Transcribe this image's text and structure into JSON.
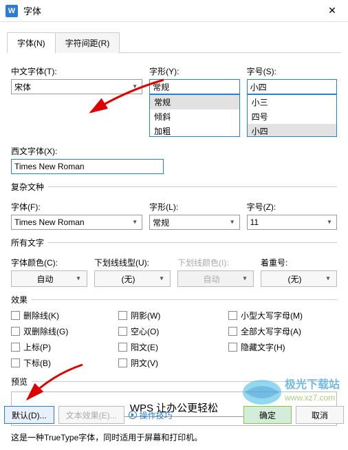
{
  "title": "字体",
  "app_icon": "W",
  "tabs": {
    "font": "字体(N)",
    "spacing": "字符间距(R)"
  },
  "main": {
    "chinese_font_label": "中文字体(T):",
    "chinese_font_value": "宋体",
    "style_label": "字形(Y):",
    "style_value": "常规",
    "style_options": [
      "常规",
      "倾斜",
      "加粗"
    ],
    "size_label": "字号(S):",
    "size_value": "小四",
    "size_options": [
      "小三",
      "四号",
      "小四"
    ],
    "western_font_label": "西文字体(X):",
    "western_font_value": "Times New Roman"
  },
  "complex": {
    "header": "复杂文种",
    "font_label": "字体(F):",
    "font_value": "Times New Roman",
    "style_label": "字形(L):",
    "style_value": "常规",
    "size_label": "字号(Z):",
    "size_value": "11"
  },
  "alltext": {
    "header": "所有文字",
    "color_label": "字体颜色(C):",
    "color_value": "自动",
    "underline_label": "下划线线型(U):",
    "underline_value": "(无)",
    "ul_color_label": "下划线颜色(I):",
    "ul_color_value": "自动",
    "emphasis_label": "着重号:",
    "emphasis_value": "(无)"
  },
  "effects": {
    "header": "效果",
    "strike": "删除线(K)",
    "dstrike": "双删除线(G)",
    "super": "上标(P)",
    "sub": "下标(B)",
    "shadow": "阴影(W)",
    "hollow": "空心(O)",
    "emboss": "阳文(E)",
    "engrave": "阴文(V)",
    "smallcaps": "小型大写字母(M)",
    "allcaps": "全部大写字母(A)",
    "hidden": "隐藏文字(H)"
  },
  "preview": {
    "header": "预览",
    "text": "WPS 让办公更轻松",
    "desc": "这是一种TrueType字体，同时适用于屏幕和打印机。"
  },
  "footer": {
    "default": "默认(D)...",
    "texteffect": "文本效果(E)...",
    "tips": "操作技巧",
    "ok": "确定",
    "cancel": "取消"
  },
  "watermark": {
    "line1": "极光下载站",
    "line2": "www.xz7.com"
  }
}
